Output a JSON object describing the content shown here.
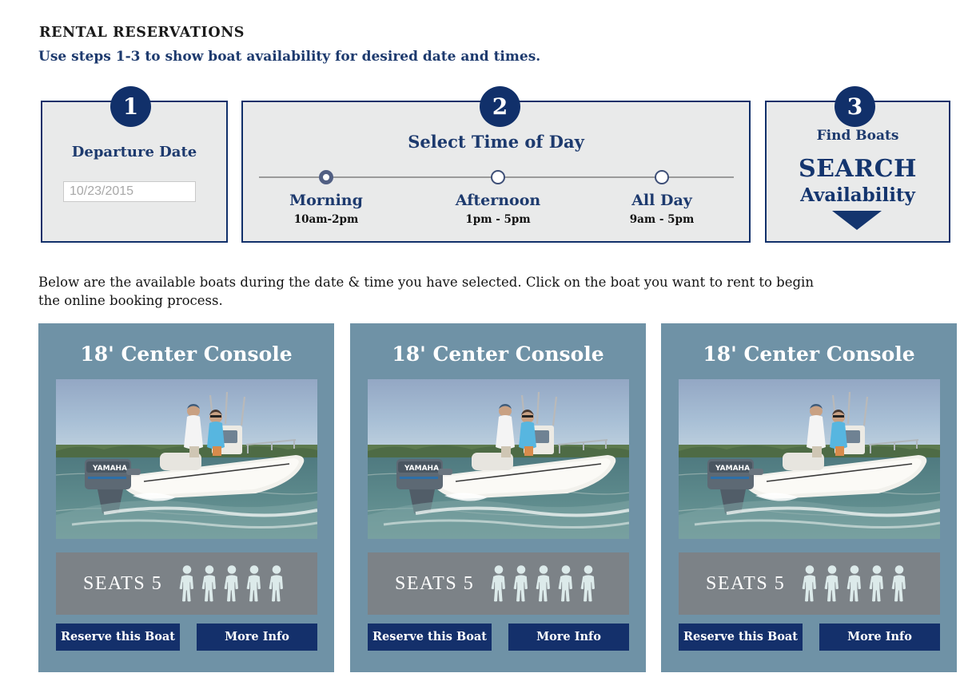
{
  "header": {
    "title": "RENTAL RESERVATIONS",
    "subtitle": "Use steps 1-3 to show boat availability for desired date and times.",
    "accent_navy": "#14306b",
    "link_blue": "#1d3a6e"
  },
  "steps": {
    "step1": {
      "badge": "1",
      "label": "Departure Date",
      "date_value": "",
      "date_placeholder": "10/23/2015"
    },
    "step2": {
      "badge": "2",
      "title": "Select Time of Day",
      "selected": "Morning",
      "options": [
        {
          "name": "Morning",
          "time": "10am-2pm",
          "selected": true
        },
        {
          "name": "Afternoon",
          "time": "1pm - 5pm",
          "selected": false
        },
        {
          "name": "All Day",
          "time": "9am - 5pm",
          "selected": false
        }
      ]
    },
    "step3": {
      "badge": "3",
      "find_label": "Find Boats",
      "search_word": "SEARCH",
      "availability_word": "Availability"
    }
  },
  "instructions": "Below are the available boats during the date & time you have selected. Click on the boat you want to rent to begin the online booking process.",
  "cards": [
    {
      "title": "18' Center Console",
      "seats_label": "SEATS 5",
      "seats_count": 5,
      "reserve_label": "Reserve this Boat",
      "info_label": "More Info"
    },
    {
      "title": "18' Center Console",
      "seats_label": "SEATS 5",
      "seats_count": 5,
      "reserve_label": "Reserve this Boat",
      "info_label": "More Info"
    },
    {
      "title": "18' Center Console",
      "seats_label": "SEATS 5",
      "seats_count": 5,
      "reserve_label": "Reserve this Boat",
      "info_label": "More Info"
    }
  ],
  "colors": {
    "card_bg": "#6f92a6",
    "seats_bar": "#7c8287",
    "person_icon": "#dceaea",
    "step_box_bg": "#e9eaea",
    "step_box_border": "#11306a"
  }
}
